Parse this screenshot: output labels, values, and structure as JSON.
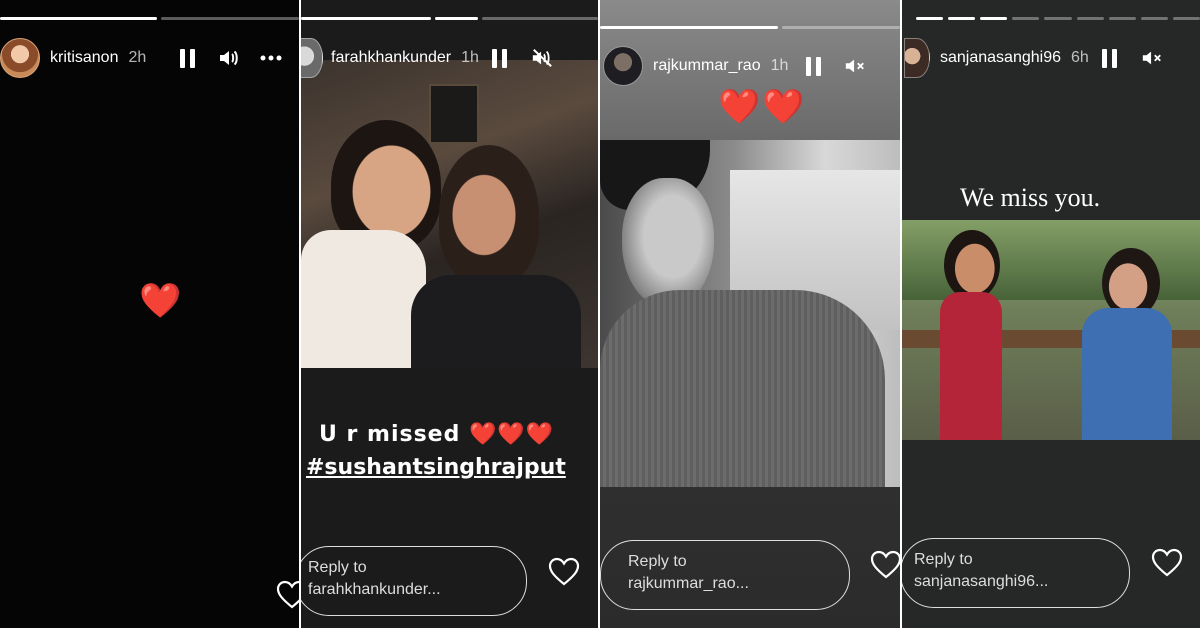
{
  "stories": [
    {
      "username": "kritisanon",
      "time": "2h",
      "center_emoji": "❤️",
      "progress_segments": 2,
      "progress_active": 0
    },
    {
      "username": "farahkhankunder",
      "time": "1h",
      "caption_line1": "U r missed ❤️❤️❤️",
      "caption_hashtag": "#sushantsinghrajput",
      "reply_prefix": "Reply to",
      "reply_target": "farahkhankunder...",
      "progress_segments": 3,
      "progress_active": 1
    },
    {
      "username": "rajkummar_rao",
      "time": "1h",
      "hearts": "❤️❤️",
      "reply_prefix": "Reply to",
      "reply_target": "rajkummar_rao...",
      "progress_segments": 2,
      "progress_active": 0
    },
    {
      "username": "sanjanasanghi96",
      "time": "6h",
      "caption": "We miss you.",
      "reply_prefix": "Reply to",
      "reply_target": "sanjanasanghi96...",
      "progress_segments": 9,
      "progress_active": 3
    }
  ],
  "icons": {
    "pause": "pause-icon",
    "volume": "volume-icon",
    "mute": "mute-icon",
    "more": "more-icon",
    "like": "heart-outline-icon"
  },
  "colors": {
    "heart": "#e0202e",
    "text": "#ffffff"
  }
}
